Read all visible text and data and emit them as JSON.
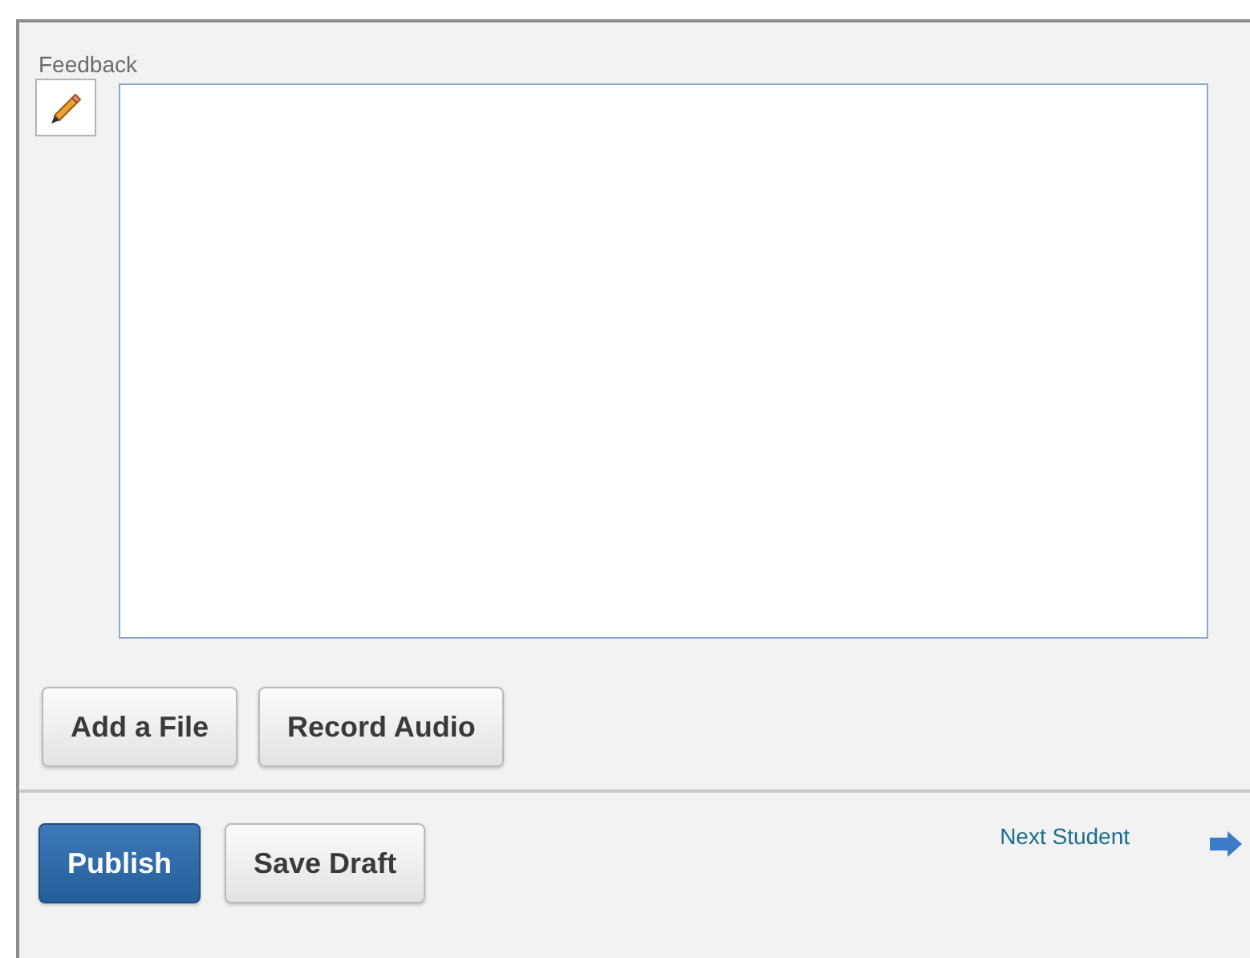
{
  "feedback": {
    "label": "Feedback"
  },
  "attachment_buttons": [
    {
      "label": "Add a File"
    },
    {
      "label": "Record Audio"
    }
  ],
  "action_buttons": [
    {
      "label": "Publish",
      "kind": "primary"
    },
    {
      "label": "Save Draft",
      "kind": "default"
    }
  ],
  "next_link": {
    "label": "Next Student"
  }
}
